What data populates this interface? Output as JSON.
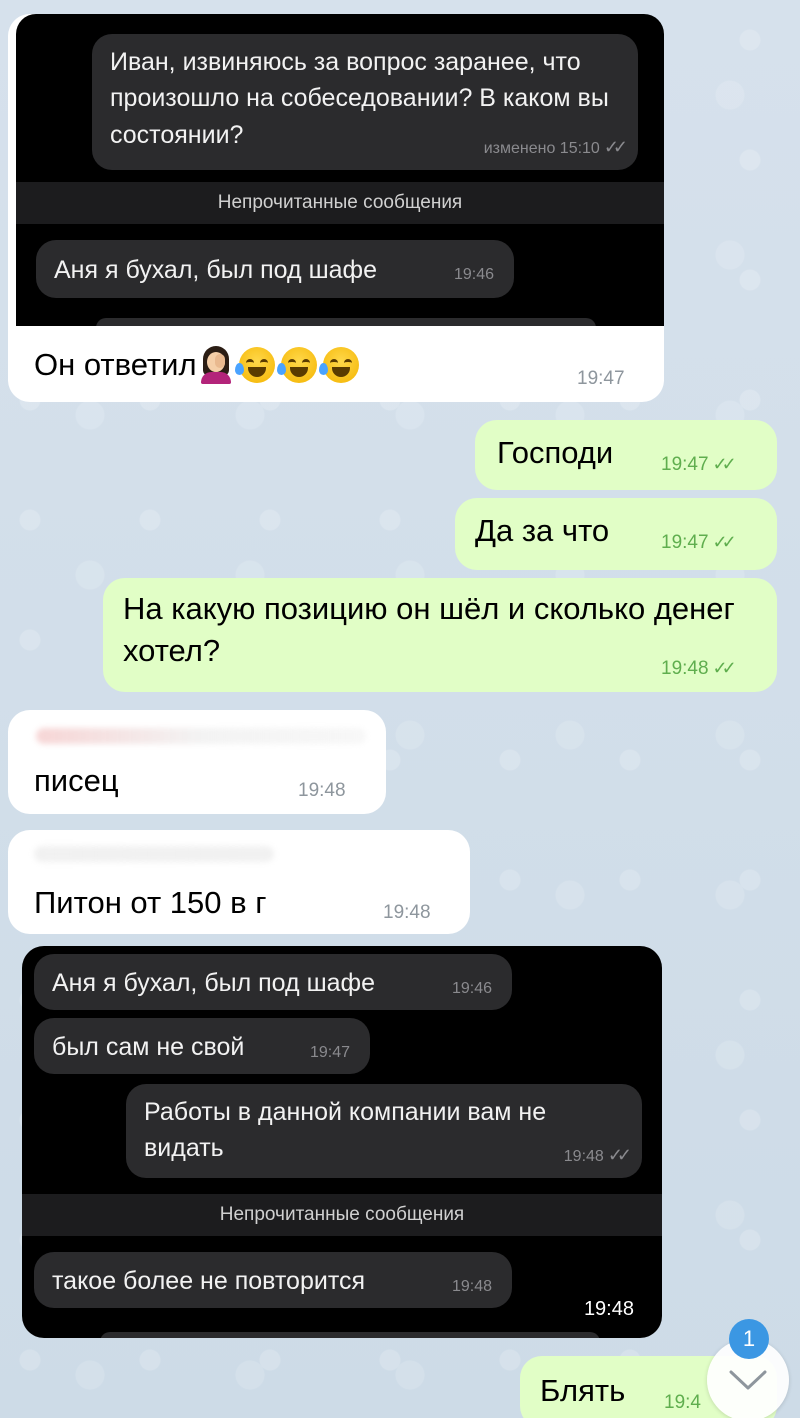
{
  "screenshot_block_1": {
    "question": "Иван, извиняюсь за вопрос заранее, что произошло на собеседовании? В каком вы состоянии?",
    "question_time": "изменено 15:10",
    "unread_label": "Непрочитанные сообщения",
    "reply": "Аня я бухал, был под шафе",
    "reply_time": "19:46"
  },
  "message_1": {
    "text": "Он ответил",
    "time": "19:47"
  },
  "message_2": {
    "text": "Господи",
    "time": "19:47"
  },
  "message_3": {
    "text": "Да за что",
    "time": "19:47"
  },
  "message_4": {
    "text": "На какую позицию он шёл и сколько денег хотел?",
    "time": "19:48"
  },
  "message_5": {
    "text": "писец",
    "time": "19:48"
  },
  "message_6": {
    "text": "Питон от 150 в г",
    "time": "19:48"
  },
  "screenshot_block_2": {
    "msg1": "Аня я бухал, был под шафе",
    "msg1_time": "19:46",
    "msg2": "был сам не свой",
    "msg2_time": "19:47",
    "msg3": "Работы в данной компании вам не видать",
    "msg3_time": "19:48",
    "unread_label": "Непрочитанные сообщения",
    "msg4": "такое более не повторится",
    "msg4_time": "19:48",
    "block_time": "19:48"
  },
  "message_7": {
    "text": "Блять",
    "time": "19:4"
  },
  "scroll_button": {
    "unread_count": "1"
  },
  "check_marks": "✓✓",
  "colors": {
    "incoming_bubble": "#ffffff",
    "outgoing_bubble": "#e1fec6",
    "outgoing_time": "#5fae4e",
    "badge": "#3b97e3"
  }
}
